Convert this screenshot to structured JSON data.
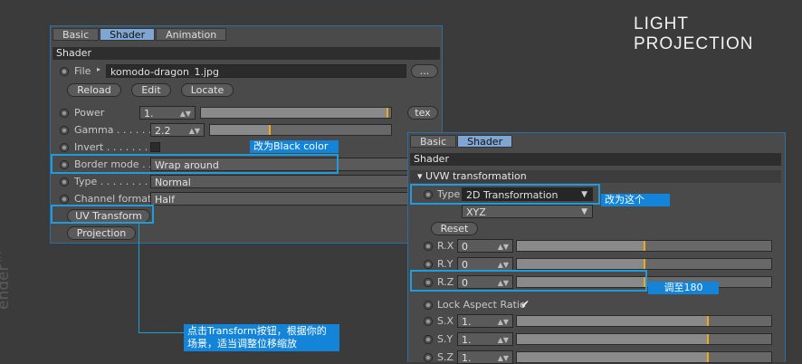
{
  "page_title": "LIGHT PROJECTION",
  "side_text": "ender™",
  "left_panel": {
    "tabs": [
      "Basic",
      "Shader",
      "Animation"
    ],
    "section": "Shader",
    "file_label": "File",
    "file_value": "komodo-dragon_1.jpg",
    "file_browse": "...",
    "btn_reload": "Reload",
    "btn_edit": "Edit",
    "btn_locate": "Locate",
    "power_label": "Power",
    "power_value": "1.",
    "power_level": 0.98,
    "btn_tex": "tex",
    "gamma_label": "Gamma . . . . . .",
    "gamma_value": "2.2",
    "gamma_level": 0.33,
    "invert_label": "Invert . . . . . . .",
    "border_label": "Border mode . .",
    "border_value": "Wrap around",
    "type_label": "Type . . . . . . . .",
    "type_value": "Normal",
    "channel_label": "Channel format",
    "channel_value": "Half",
    "btn_uv": "UV Transform",
    "btn_projection": "Projection"
  },
  "right_panel": {
    "tabs": [
      "Basic",
      "Shader"
    ],
    "section": "Shader",
    "subsection": "▾ UVW transformation",
    "type_label": "Type",
    "type_value": "2D Transformation",
    "xyz_value": "XYZ",
    "btn_reset": "Reset",
    "rows": [
      {
        "label": "R.X",
        "value": "0",
        "level": 0.5
      },
      {
        "label": "R.Y",
        "value": "0",
        "level": 0.5
      },
      {
        "label": "R.Z",
        "value": "0",
        "level": 0.5
      }
    ],
    "lock_label": "Lock Aspect Ratio",
    "lock_check": "✔",
    "scale_rows": [
      {
        "label": "S.X",
        "value": "1.",
        "level": 0.75
      },
      {
        "label": "S.Y",
        "value": "1.",
        "level": 0.75
      },
      {
        "label": "S.Z",
        "value": "1.",
        "level": 0.75
      }
    ]
  },
  "annotations": {
    "note_black": "改为Black color",
    "note_this": "改为这个",
    "note_180": "调至180",
    "note_transform_l1": "点击Transform按钮，根据你的",
    "note_transform_l2": "场景，适当调整位移缩放"
  },
  "colors": {
    "accent": "#1e9cdb",
    "note_bg": "#1484d9",
    "slider_mark": "#f0a81c",
    "tab_active": "#7fa5d2"
  }
}
